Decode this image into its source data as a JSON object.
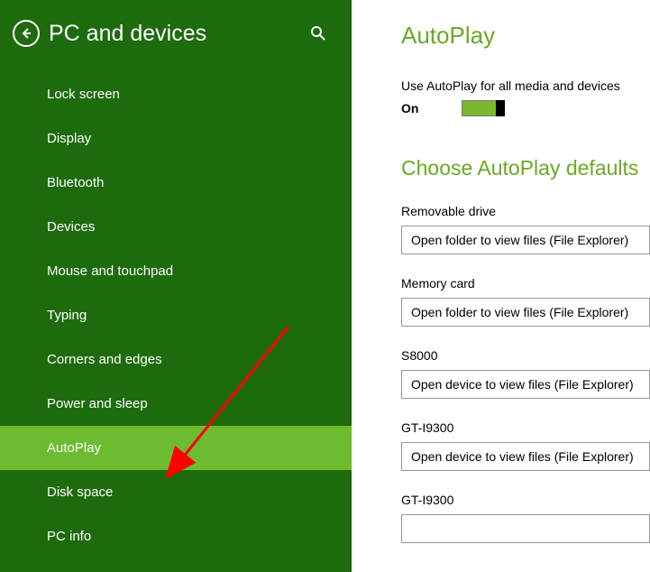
{
  "sidebar": {
    "title": "PC and devices",
    "items": [
      {
        "label": "Lock screen"
      },
      {
        "label": "Display"
      },
      {
        "label": "Bluetooth"
      },
      {
        "label": "Devices"
      },
      {
        "label": "Mouse and touchpad"
      },
      {
        "label": "Typing"
      },
      {
        "label": "Corners and edges"
      },
      {
        "label": "Power and sleep"
      },
      {
        "label": "AutoPlay"
      },
      {
        "label": "Disk space"
      },
      {
        "label": "PC info"
      }
    ]
  },
  "main": {
    "title": "AutoPlay",
    "toggle": {
      "label": "Use AutoPlay for all media and devices",
      "state": "On"
    },
    "sectionTitle": "Choose AutoPlay defaults",
    "settings": [
      {
        "label": "Removable drive",
        "value": "Open folder to view files (File Explorer)"
      },
      {
        "label": "Memory card",
        "value": "Open folder to view files (File Explorer)"
      },
      {
        "label": "S8000",
        "value": "Open device to view files (File Explorer)"
      },
      {
        "label": "GT-I9300",
        "value": "Open device to view files (File Explorer)"
      },
      {
        "label": "GT-I9300",
        "value": ""
      }
    ]
  },
  "colors": {
    "sidebarBg": "#1e6b0e",
    "activeBg": "#6dbb2f",
    "accent": "#6aa925"
  }
}
